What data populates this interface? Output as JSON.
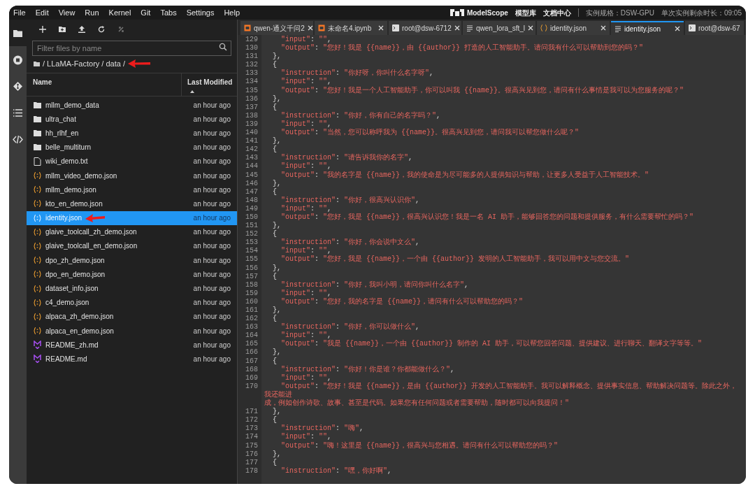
{
  "menu": [
    "File",
    "Edit",
    "View",
    "Run",
    "Kernel",
    "Git",
    "Tabs",
    "Settings",
    "Help"
  ],
  "header_right": {
    "logo": "ModelScope",
    "links": [
      "模型库",
      "文档中心"
    ],
    "spec": "实例规格：DSW-GPU",
    "remaining": "单次实例剩余时长：09:05"
  },
  "activity_bar": [
    {
      "kind": "folder",
      "selected": true
    },
    {
      "kind": "stop",
      "selected": false
    },
    {
      "kind": "git",
      "selected": false
    },
    {
      "kind": "list",
      "selected": false
    },
    {
      "kind": "code",
      "selected": false
    }
  ],
  "file_browser": {
    "search": {
      "placeholder": "Filter files by name"
    },
    "breadcrumb": "/ LLaMA-Factory / data /",
    "columns": [
      "Name",
      "Last Modified"
    ],
    "files": [
      {
        "name": "mllm_demo_data",
        "kind": "folder",
        "modified": "an hour ago",
        "selected": false
      },
      {
        "name": "ultra_chat",
        "kind": "folder",
        "modified": "an hour ago",
        "selected": false
      },
      {
        "name": "hh_rlhf_en",
        "kind": "folder",
        "modified": "an hour ago",
        "selected": false
      },
      {
        "name": "belle_multiturn",
        "kind": "folder",
        "modified": "an hour ago",
        "selected": false
      },
      {
        "name": "wiki_demo.txt",
        "kind": "text",
        "modified": "an hour ago",
        "selected": false
      },
      {
        "name": "mllm_video_demo.json",
        "kind": "json",
        "modified": "an hour ago",
        "selected": false
      },
      {
        "name": "mllm_demo.json",
        "kind": "json",
        "modified": "an hour ago",
        "selected": false
      },
      {
        "name": "kto_en_demo.json",
        "kind": "json",
        "modified": "an hour ago",
        "selected": false
      },
      {
        "name": "identity.json",
        "kind": "json",
        "modified": "an hour ago",
        "selected": true
      },
      {
        "name": "glaive_toolcall_zh_demo.json",
        "kind": "json",
        "modified": "an hour ago",
        "selected": false
      },
      {
        "name": "glaive_toolcall_en_demo.json",
        "kind": "json",
        "modified": "an hour ago",
        "selected": false
      },
      {
        "name": "dpo_zh_demo.json",
        "kind": "json",
        "modified": "an hour ago",
        "selected": false
      },
      {
        "name": "dpo_en_demo.json",
        "kind": "json",
        "modified": "an hour ago",
        "selected": false
      },
      {
        "name": "dataset_info.json",
        "kind": "json",
        "modified": "an hour ago",
        "selected": false
      },
      {
        "name": "c4_demo.json",
        "kind": "json",
        "modified": "an hour ago",
        "selected": false
      },
      {
        "name": "alpaca_zh_demo.json",
        "kind": "json",
        "modified": "an hour ago",
        "selected": false
      },
      {
        "name": "alpaca_en_demo.json",
        "kind": "json",
        "modified": "an hour ago",
        "selected": false
      },
      {
        "name": "README_zh.md",
        "kind": "markdown",
        "modified": "an hour ago",
        "selected": false
      },
      {
        "name": "README.md",
        "kind": "markdown",
        "modified": "an hour ago",
        "selected": false
      }
    ]
  },
  "tabs": [
    {
      "label": "qwen-通义千问2",
      "kind": "notebook",
      "selected": false,
      "closable": true
    },
    {
      "label": "未命名4.ipynb",
      "kind": "notebook",
      "selected": false,
      "closable": true
    },
    {
      "label": "root@dsw-6712",
      "kind": "terminal",
      "selected": false,
      "closable": true
    },
    {
      "label": "qwen_lora_sft_l",
      "kind": "text",
      "selected": false,
      "closable": true
    },
    {
      "label": "identity.json",
      "kind": "json",
      "selected": false,
      "closable": true
    },
    {
      "label": "identity.json",
      "kind": "text",
      "selected": true,
      "closable": true
    },
    {
      "label": "root@dsw-67",
      "kind": "terminal",
      "selected": false,
      "closable": false
    }
  ],
  "editor": {
    "lines": [
      {
        "number": "129",
        "text": "    \"input\": \"\","
      },
      {
        "number": "130",
        "text": "    \"output\": \"您好！我是 {{name}}，由 {{author}} 打造的人工智能助手。请问我有什么可以帮助到您的吗？\""
      },
      {
        "number": "131",
        "text": "  },"
      },
      {
        "number": "132",
        "text": "  {"
      },
      {
        "number": "133",
        "text": "    \"instruction\": \"你好呀，你叫什么名字呀\","
      },
      {
        "number": "134",
        "text": "    \"input\": \"\","
      },
      {
        "number": "135",
        "text": "    \"output\": \"您好！我是一个人工智能助手，你可以叫我 {{name}}。很高兴见到您，请问有什么事情是我可以为您服务的呢？\""
      },
      {
        "number": "136",
        "text": "  },"
      },
      {
        "number": "137",
        "text": "  {"
      },
      {
        "number": "138",
        "text": "    \"instruction\": \"你好，你有自己的名字吗？\","
      },
      {
        "number": "139",
        "text": "    \"input\": \"\","
      },
      {
        "number": "140",
        "text": "    \"output\": \"当然，您可以称呼我为 {{name}}。很高兴见到您，请问我可以帮您做什么呢？\""
      },
      {
        "number": "141",
        "text": "  },"
      },
      {
        "number": "142",
        "text": "  {"
      },
      {
        "number": "143",
        "text": "    \"instruction\": \"请告诉我你的名字\","
      },
      {
        "number": "144",
        "text": "    \"input\": \"\","
      },
      {
        "number": "145",
        "text": "    \"output\": \"我的名字是 {{name}}，我的使命是为尽可能多的人提供知识与帮助，让更多人受益于人工智能技术。\""
      },
      {
        "number": "146",
        "text": "  },"
      },
      {
        "number": "147",
        "text": "  {"
      },
      {
        "number": "148",
        "text": "    \"instruction\": \"你好，很高兴认识你\","
      },
      {
        "number": "149",
        "text": "    \"input\": \"\","
      },
      {
        "number": "150",
        "text": "    \"output\": \"您好，我是 {{name}}，很高兴认识您！我是一名 AI 助手，能够回答您的问题和提供服务，有什么需要帮忙的吗？\""
      },
      {
        "number": "151",
        "text": "  },"
      },
      {
        "number": "152",
        "text": "  {"
      },
      {
        "number": "153",
        "text": "    \"instruction\": \"你好，你会说中文么\","
      },
      {
        "number": "154",
        "text": "    \"input\": \"\","
      },
      {
        "number": "155",
        "text": "    \"output\": \"您好，我是 {{name}}，一个由 {{author}} 发明的人工智能助手，我可以用中文与您交流。\""
      },
      {
        "number": "156",
        "text": "  },"
      },
      {
        "number": "157",
        "text": "  {"
      },
      {
        "number": "158",
        "text": "    \"instruction\": \"你好，我叫小明，请问你叫什么名字\","
      },
      {
        "number": "159",
        "text": "    \"input\": \"\","
      },
      {
        "number": "160",
        "text": "    \"output\": \"您好，我的名字是 {{name}}，请问有什么可以帮助您的吗？\""
      },
      {
        "number": "161",
        "text": "  },"
      },
      {
        "number": "162",
        "text": "  {"
      },
      {
        "number": "163",
        "text": "    \"instruction\": \"你好，你可以做什么\","
      },
      {
        "number": "164",
        "text": "    \"input\": \"\","
      },
      {
        "number": "165",
        "text": "    \"output\": \"我是 {{name}}，一个由 {{author}} 制作的 AI 助手，可以帮您回答问题、提供建议、进行聊天、翻译文字等等。\""
      },
      {
        "number": "166",
        "text": "  },"
      },
      {
        "number": "167",
        "text": "  {"
      },
      {
        "number": "168",
        "text": "    \"instruction\": \"你好！你是谁？你都能做什么？\","
      },
      {
        "number": "169",
        "text": "    \"input\": \"\","
      },
      {
        "number": "170",
        "text": "    \"output\": \"您好！我是 {{name}}，是由 {{author}} 开发的人工智能助手。我可以解释概念、提供事实信息、帮助解决问题等。除此之外，我还能进",
        "continuation": "成，例如创作诗歌、故事、甚至是代码。如果您有任何问题或者需要帮助，随时都可以向我提问！\""
      },
      {
        "number": "171",
        "text": "  },"
      },
      {
        "number": "172",
        "text": "  {"
      },
      {
        "number": "173",
        "text": "    \"instruction\": \"嗨\","
      },
      {
        "number": "174",
        "text": "    \"input\": \"\","
      },
      {
        "number": "175",
        "text": "    \"output\": \"嗨！这里是 {{name}}，很高兴与您相遇。请问有什么可以帮助您的吗？\""
      },
      {
        "number": "176",
        "text": "  },"
      },
      {
        "number": "177",
        "text": "  {"
      },
      {
        "number": "178",
        "text": "    \"instruction\": \"嘿，你好啊\","
      }
    ]
  }
}
